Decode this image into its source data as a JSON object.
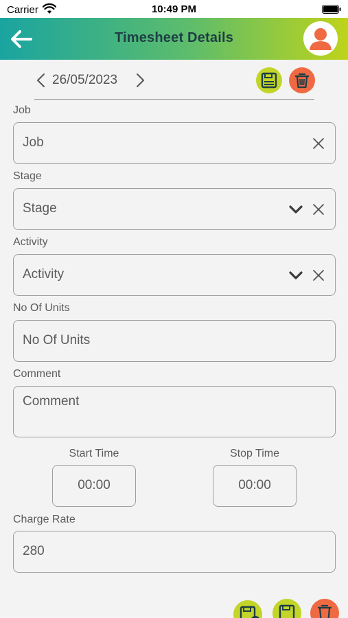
{
  "status_bar": {
    "carrier": "Carrier",
    "time": "10:49 PM"
  },
  "header": {
    "title": "Timesheet Details",
    "icons": [
      "back-arrow-icon",
      "user-avatar-icon"
    ]
  },
  "date_nav": {
    "date": "26/05/2023",
    "icons": [
      "chevron-left-icon",
      "chevron-right-icon",
      "save-icon",
      "trash-icon"
    ]
  },
  "form": {
    "job": {
      "label": "Job",
      "placeholder": "Job",
      "value": ""
    },
    "stage": {
      "label": "Stage",
      "placeholder": "Stage",
      "value": ""
    },
    "activity": {
      "label": "Activity",
      "placeholder": "Activity",
      "value": ""
    },
    "units": {
      "label": "No Of Units",
      "placeholder": "No Of Units",
      "value": ""
    },
    "comment": {
      "label": "Comment",
      "placeholder": "Comment",
      "value": ""
    },
    "start_time": {
      "label": "Start Time",
      "value": "00:00"
    },
    "stop_time": {
      "label": "Stop Time",
      "value": "00:00"
    },
    "charge_rate": {
      "label": "Charge Rate",
      "value": "280"
    }
  },
  "colors": {
    "accent_teal": "#1aa4a0",
    "accent_lime": "#bfd31a",
    "save_button": "#c2d528",
    "delete_button": "#ef6a43",
    "title_text": "#1f3d45"
  }
}
